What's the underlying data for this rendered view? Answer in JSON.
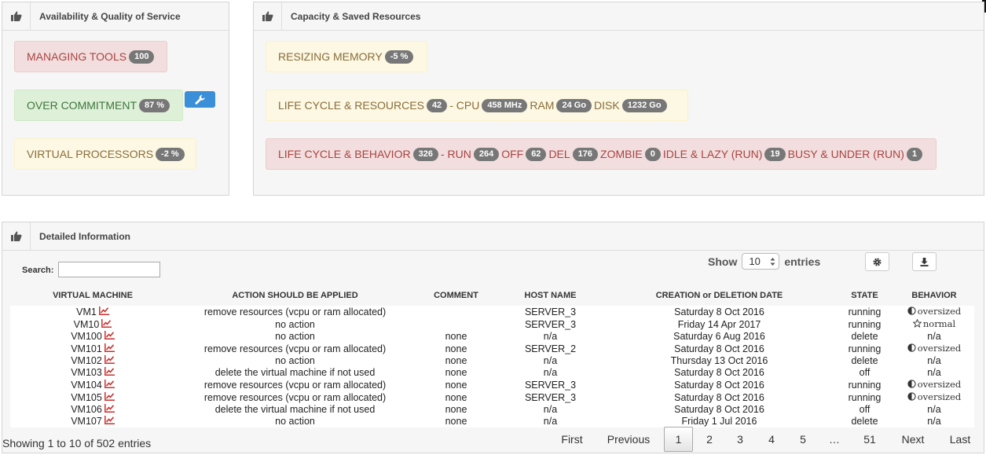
{
  "panels": {
    "availability": {
      "title": "Availability & Quality of Service",
      "tags": [
        {
          "label": "MANAGING TOOLS",
          "badge": "100"
        },
        {
          "label": "OVER COMMITMENT",
          "badge": "87 %"
        },
        {
          "label": "VIRTUAL PROCESSORS",
          "badge": "-2 %"
        }
      ]
    },
    "capacity": {
      "title": "Capacity & Saved Resources",
      "resizing": {
        "label": "RESIZING MEMORY",
        "badge": "-5 %"
      },
      "lifecycle_resources": {
        "label": "LIFE CYCLE & RESOURCES",
        "badge": "42",
        "cpu_label": "- CPU",
        "cpu": "458 MHz",
        "ram_label": "RAM",
        "ram": "24 Go",
        "disk_label": "DISK",
        "disk": "1232 Go"
      },
      "lifecycle_behavior": {
        "label": "LIFE CYCLE & BEHAVIOR",
        "badge": "326",
        "run_label": "- RUN",
        "run": "264",
        "off_label": "OFF",
        "off": "62",
        "del_label": "DEL",
        "del": "176",
        "zombie_label": "ZOMBIE",
        "zombie": "0",
        "idle_label": "IDLE & LAZY (RUN)",
        "idle": "19",
        "busy_label": "BUSY & UNDER (RUN)",
        "busy": "1"
      }
    },
    "detailed": {
      "title": "Detailed Information"
    }
  },
  "controls": {
    "search_label": "Search:",
    "search_value": "",
    "show_label": "Show",
    "show_value": "10",
    "entries_label": "entries"
  },
  "table": {
    "columns": [
      "VIRTUAL MACHINE",
      "ACTION SHOULD BE APPLIED",
      "COMMENT",
      "HOST NAME",
      "CREATION or DELETION DATE",
      "STATE",
      "BEHAVIOR"
    ],
    "rows": [
      {
        "vm": "VM1",
        "action": "remove resources (vcpu or ram allocated)",
        "comment": "",
        "host": "SERVER_3",
        "date": "Saturday 8 Oct 2016",
        "state": "running",
        "behavior": "oversized",
        "beh_icon": "half-circle"
      },
      {
        "vm": "VM10",
        "action": "no action",
        "comment": "",
        "host": "SERVER_3",
        "date": "Friday 14 Apr 2017",
        "state": "running",
        "behavior": "normal",
        "beh_icon": "star"
      },
      {
        "vm": "VM100",
        "action": "no action",
        "comment": "none",
        "host": "n/a",
        "date": "Saturday 6 Aug 2016",
        "state": "delete",
        "behavior": "n/a",
        "beh_icon": ""
      },
      {
        "vm": "VM101",
        "action": "remove resources (vcpu or ram allocated)",
        "comment": "none",
        "host": "SERVER_2",
        "date": "Saturday 8 Oct 2016",
        "state": "running",
        "behavior": "oversized",
        "beh_icon": "half-circle"
      },
      {
        "vm": "VM102",
        "action": "no action",
        "comment": "none",
        "host": "n/a",
        "date": "Thursday 13 Oct 2016",
        "state": "delete",
        "behavior": "n/a",
        "beh_icon": ""
      },
      {
        "vm": "VM103",
        "action": "delete the virtual machine if not used",
        "comment": "none",
        "host": "n/a",
        "date": "Saturday 8 Oct 2016",
        "state": "off",
        "behavior": "n/a",
        "beh_icon": ""
      },
      {
        "vm": "VM104",
        "action": "remove resources (vcpu or ram allocated)",
        "comment": "none",
        "host": "SERVER_3",
        "date": "Saturday 8 Oct 2016",
        "state": "running",
        "behavior": "oversized",
        "beh_icon": "half-circle"
      },
      {
        "vm": "VM105",
        "action": "remove resources (vcpu or ram allocated)",
        "comment": "none",
        "host": "SERVER_3",
        "date": "Saturday 8 Oct 2016",
        "state": "running",
        "behavior": "oversized",
        "beh_icon": "half-circle"
      },
      {
        "vm": "VM106",
        "action": "delete the virtual machine if not used",
        "comment": "none",
        "host": "n/a",
        "date": "Saturday 8 Oct 2016",
        "state": "off",
        "behavior": "n/a",
        "beh_icon": ""
      },
      {
        "vm": "VM107",
        "action": "no action",
        "comment": "none",
        "host": "n/a",
        "date": "Friday 1 Jul 2016",
        "state": "delete",
        "behavior": "n/a",
        "beh_icon": ""
      }
    ]
  },
  "footer": {
    "info": "Showing 1 to 10 of 502 entries",
    "pager": {
      "first": "First",
      "previous": "Previous",
      "pages": [
        "1",
        "2",
        "3",
        "4",
        "5"
      ],
      "ellipsis": "…",
      "last_page": "51",
      "next": "Next",
      "last": "Last"
    }
  },
  "colors": {
    "chart_icon": "#c9302c",
    "wrench_button": "#3a8fd8"
  }
}
